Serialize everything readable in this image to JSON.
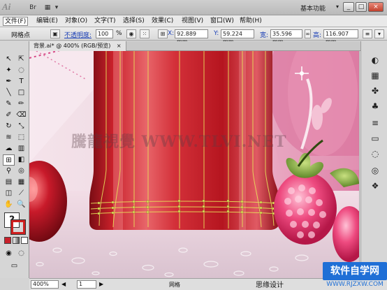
{
  "app": {
    "logo_text": "Ai",
    "workspace_label": "基本功能",
    "window_buttons": [
      "_",
      "□",
      "×"
    ]
  },
  "menu": {
    "items": [
      "文件(F)",
      "编辑(E)",
      "对象(O)",
      "文字(T)",
      "选择(S)",
      "效果(C)",
      "视图(V)",
      "窗口(W)",
      "帮助(H)"
    ]
  },
  "control": {
    "mode_label": "网格点",
    "opacity_label": "不透明度:",
    "opacity_value": "100",
    "opacity_unit": "%",
    "x_label": "X:",
    "x_value": "92.889 mm",
    "y_label": "Y:",
    "y_value": "59.224 mm",
    "w_label": "宽:",
    "w_value": "35.596 mm",
    "h_label": "高:",
    "h_value": "116.907 mm"
  },
  "document": {
    "tab_title": "背景.ai* @ 400% (RGB/预览)",
    "close_glyph": "×"
  },
  "canvas": {
    "watermark": "騰龍視覺 WWW.TLVI.NET"
  },
  "status": {
    "zoom": "400%",
    "page": "1",
    "tool_name": "网格",
    "prev_glyph": "◀",
    "next_glyph": "▶"
  },
  "overlay": {
    "caption": "思缘设计",
    "brand_logo": "软件自学网",
    "brand_url": "WWW.RJZXW.COM"
  },
  "colors": {
    "bottle_red": "#c8202a",
    "mesh_yellow": "#e8e05a",
    "raspberry": "#e8336e",
    "bg_pink": "#e9a7c1",
    "accent_blue": "#1f6fd6"
  }
}
